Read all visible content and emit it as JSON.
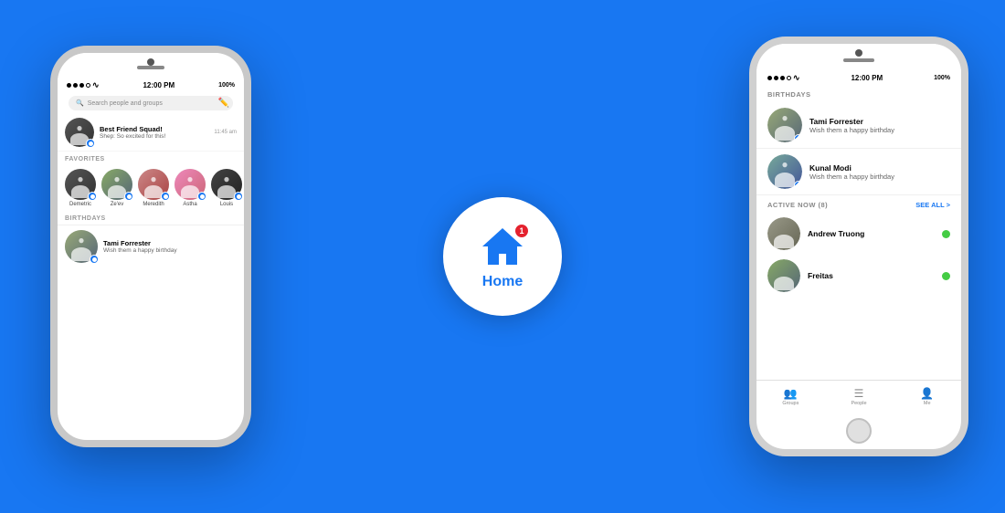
{
  "background_color": "#1877f2",
  "left_phone": {
    "status_bar": {
      "signal": "●●●○",
      "wifi": "WiFi",
      "time": "12:00 PM",
      "battery": "100%"
    },
    "search_placeholder": "Search people and groups",
    "chat_items": [
      {
        "name": "Best Friend Squad!",
        "preview": "Shep: So excited for this!",
        "time": "11:45 am"
      }
    ],
    "sections": {
      "favorites_label": "FAVORITES",
      "favorites": [
        {
          "name": "Demetric",
          "color": "av-demetric"
        },
        {
          "name": "Ze'ev",
          "color": "av-zeev"
        },
        {
          "name": "Meredith",
          "color": "av-meredith"
        },
        {
          "name": "Astha",
          "color": "av-astha"
        },
        {
          "name": "Louis",
          "color": "av-louis"
        }
      ],
      "birthdays_label": "BIRTHDAYS",
      "birthday_items": [
        {
          "name": "Tami Forrester",
          "sub": "Wish them a happy birthday",
          "color": "av-tami"
        }
      ]
    }
  },
  "right_phone": {
    "status_bar": {
      "signal": "●●●○",
      "wifi": "WiFi",
      "time": "12:00 PM",
      "battery": "100%"
    },
    "birthdays_section": {
      "label": "BIRTHDAYS",
      "items": [
        {
          "name": "Tami Forrester",
          "sub": "Wish them a happy birthday",
          "color": "av-tami"
        },
        {
          "name": "Kunal Modi",
          "sub": "Wish them a happy birthday",
          "color": "av-kunal"
        }
      ]
    },
    "active_section": {
      "label": "ACTIVE NOW (8)",
      "see_all": "SEE ALL >",
      "items": [
        {
          "name": "Andrew Truong",
          "color": "av-andrew"
        },
        {
          "name": "Freitas",
          "color": "av-zeev"
        }
      ]
    },
    "bottom_nav": [
      {
        "icon": "⊞",
        "label": "Groups"
      },
      {
        "icon": "☰",
        "label": "People"
      },
      {
        "icon": "○",
        "label": "Me"
      }
    ]
  },
  "home_bubble": {
    "badge": "1",
    "label": "Home"
  }
}
